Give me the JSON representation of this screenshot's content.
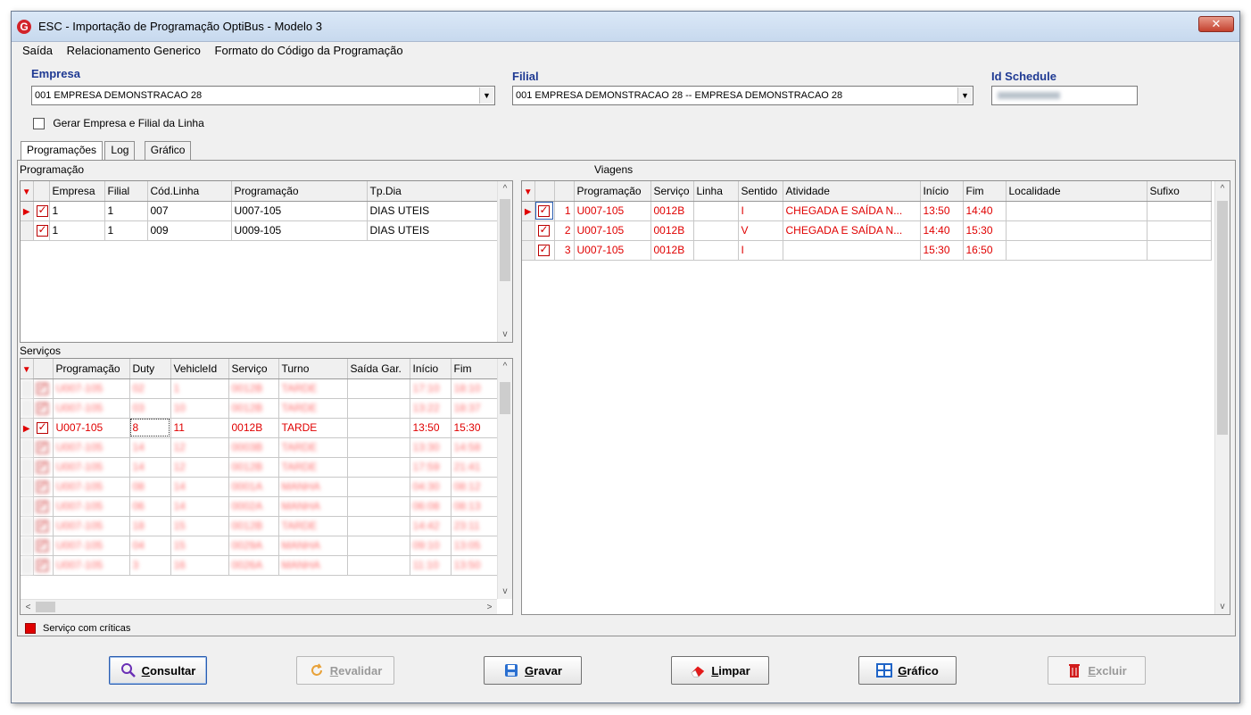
{
  "window": {
    "title": "ESC - Importação de Programação OptiBus - Modelo 3",
    "close_glyph": "✕",
    "app_icon_letter": "G"
  },
  "menu": [
    "Saída",
    "Relacionamento Generico",
    "Formato do Código da Programação"
  ],
  "header": {
    "empresa_label": "Empresa",
    "empresa_value": "001 EMPRESA DEMONSTRACAO 28",
    "filial_label": "Filial",
    "filial_value": "001 EMPRESA DEMONSTRACAO 28 -- EMPRESA DEMONSTRACAO 28",
    "id_schedule_label": "Id Schedule",
    "gerar_label": "Gerar Empresa e Filial da Linha"
  },
  "tabs": [
    "Programações",
    "Log",
    "Gráfico"
  ],
  "programacao": {
    "label": "Programação",
    "columns": [
      "Empresa",
      "Filial",
      "Cód.Linha",
      "Programação",
      "Tp.Dia"
    ],
    "rows": [
      [
        "1",
        "1",
        "007",
        "U007-105",
        "DIAS UTEIS"
      ],
      [
        "1",
        "1",
        "009",
        "U009-105",
        "DIAS UTEIS"
      ]
    ]
  },
  "servicos": {
    "label": "Serviços",
    "columns": [
      "Programação",
      "Duty",
      "VehicleId",
      "Serviço",
      "Turno",
      "Saída Gar.",
      "Início",
      "Fim"
    ],
    "selected_row": [
      "U007-105",
      "8",
      "11",
      "0012B",
      "TARDE",
      "",
      "13:50",
      "15:30"
    ],
    "blurred_rows": [
      [
        "U007-105",
        "02",
        "1",
        "0012B",
        "TARDE",
        "",
        "17:10",
        "18:10"
      ],
      [
        "U007-105",
        "03",
        "10",
        "0012B",
        "TARDE",
        "",
        "13:22",
        "18:37"
      ],
      [
        "U007-105",
        "14",
        "12",
        "0003B",
        "TARDE",
        "",
        "13:30",
        "14:58"
      ],
      [
        "U007-105",
        "14",
        "12",
        "0012B",
        "TARDE",
        "",
        "17:59",
        "21:41"
      ],
      [
        "U007-105",
        "08",
        "14",
        "0001A",
        "MANHA",
        "",
        "04:30",
        "08:12"
      ],
      [
        "U007-105",
        "06",
        "14",
        "0002A",
        "MANHA",
        "",
        "06:08",
        "08:13"
      ],
      [
        "U007-105",
        "18",
        "15",
        "0012B",
        "TARDE",
        "",
        "14:42",
        "23:11"
      ],
      [
        "U007-105",
        "04",
        "15",
        "0029A",
        "MANHA",
        "",
        "09:10",
        "13:05"
      ],
      [
        "U007-105",
        "3",
        "16",
        "0026A",
        "MANHA",
        "",
        "11:10",
        "13:50"
      ]
    ],
    "legend": "Serviço com críticas"
  },
  "viagens": {
    "label": "Viagens",
    "columns": [
      "Programação",
      "Serviço",
      "Linha",
      "Sentido",
      "Atividade",
      "Início",
      "Fim",
      "Localidade",
      "Sufixo"
    ],
    "rows": [
      [
        "1",
        "U007-105",
        "0012B",
        "",
        "I",
        "CHEGADA E SAÍDA N...",
        "13:50",
        "14:40",
        "",
        ""
      ],
      [
        "2",
        "U007-105",
        "0012B",
        "",
        "V",
        "CHEGADA E SAÍDA N...",
        "14:40",
        "15:30",
        "",
        ""
      ],
      [
        "3",
        "U007-105",
        "0012B",
        "",
        "I",
        "",
        "15:30",
        "16:50",
        "",
        ""
      ]
    ]
  },
  "buttons": {
    "consultar": "Consultar",
    "revalidar": "Revalidar",
    "gravar": "Gravar",
    "limpar": "Limpar",
    "grafico": "Gráfico",
    "excluir": "Excluir"
  },
  "colors": {
    "critical": "#e00000",
    "label_blue": "#1f3a93"
  }
}
